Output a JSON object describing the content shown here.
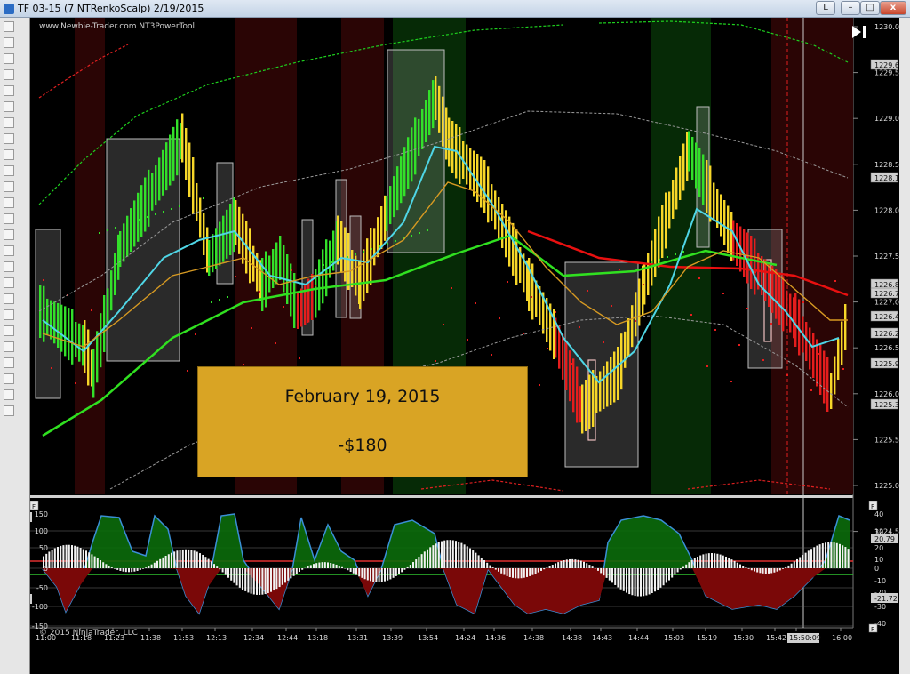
{
  "window": {
    "title": "TF 03-15 (7 NTRenkoScalp)  2/19/2015",
    "layout_button": "L",
    "minimize_glyph": "–",
    "maximize_glyph": "□",
    "close_glyph": "x"
  },
  "chart": {
    "watermark": "www.Newbie-Trader.com NT3PowerTool",
    "copyright": "© 2015 NinjaTrader, LLC",
    "price_ticks": [
      "1230.0",
      "1229.5",
      "1229.0",
      "1228.5",
      "1228.0",
      "1227.5",
      "1227.0",
      "1226.5",
      "1226.0",
      "1225.5",
      "1225.0",
      "1224.5"
    ],
    "price_tags": [
      "1229.6",
      "1228.1",
      "1226.8",
      "1226.7",
      "1226.4",
      "1226.2",
      "1225.9",
      "1225.3"
    ],
    "time_labels": [
      "11:00",
      "11:18",
      "11:23",
      "11:38",
      "11:53",
      "12:13",
      "12:34",
      "12:44",
      "13:18",
      "13:31",
      "13:39",
      "13:54",
      "14:24",
      "14:36",
      "14:38",
      "14:38",
      "14:43",
      "14:44",
      "15:03",
      "15:19",
      "15:30",
      "15:42",
      "15:50:09",
      "16:00"
    ],
    "osc_right_ticks": [
      "40",
      "30",
      "20",
      "10",
      "0",
      "-10",
      "-20",
      "-30",
      "-40"
    ],
    "osc_left_ticks": [
      "150",
      "100",
      "50",
      "0",
      "-50",
      "-100",
      "-150"
    ],
    "osc_left_tags": [
      "133.48",
      "-78.79"
    ],
    "osc_right_tags": [
      "20.79",
      "-21.72"
    ],
    "panel_flag": "F",
    "colors": {
      "up": "#33e02a",
      "down": "#e51d1d",
      "yellow": "#f6d629",
      "ma_red": "#e81010",
      "ma_green": "#30e020",
      "cyan": "#4fd6e6",
      "orange": "#d79a22"
    }
  },
  "overlay": {
    "date": "February 19, 2015",
    "amount": "-$180"
  }
}
